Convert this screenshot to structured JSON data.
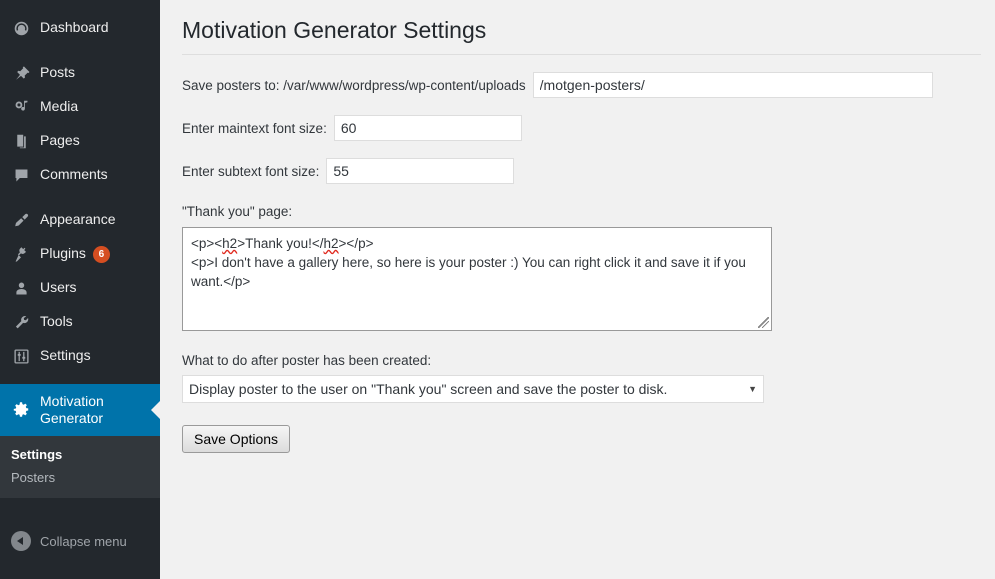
{
  "sidebar": {
    "items": [
      {
        "label": "Dashboard",
        "icon": "dashboard-icon"
      },
      {
        "label": "Posts",
        "icon": "pin-icon"
      },
      {
        "label": "Media",
        "icon": "media-icon"
      },
      {
        "label": "Pages",
        "icon": "pages-icon"
      },
      {
        "label": "Comments",
        "icon": "comment-icon"
      },
      {
        "label": "Appearance",
        "icon": "brush-icon"
      },
      {
        "label": "Plugins",
        "icon": "plug-icon",
        "badge": "6"
      },
      {
        "label": "Users",
        "icon": "user-icon"
      },
      {
        "label": "Tools",
        "icon": "wrench-icon"
      },
      {
        "label": "Settings",
        "icon": "sliders-icon"
      }
    ],
    "active_item": {
      "label": "Motivation Generator",
      "icon": "gear-icon"
    },
    "submenu": [
      {
        "label": "Settings",
        "current": true
      },
      {
        "label": "Posters",
        "current": false
      }
    ],
    "collapse_label": "Collapse menu",
    "colors": {
      "background": "#23282d",
      "submenu_background": "#32373c",
      "active": "#0073aa",
      "badge": "#d54e21"
    }
  },
  "main": {
    "page_title": "Motivation Generator Settings",
    "save_path": {
      "label": "Save posters to: /var/www/wordpress/wp-content/uploads",
      "value": "/motgen-posters/"
    },
    "maintext_font_size": {
      "label": "Enter maintext font size:",
      "value": "60"
    },
    "subtext_font_size": {
      "label": "Enter subtext font size:",
      "value": "55"
    },
    "thank_you": {
      "label": "\"Thank you\" page:",
      "line1_a": "<p><",
      "line1_spell": "h2",
      "line1_b": ">Thank you!</",
      "line1_spell2": "h2",
      "line1_c": "></p>",
      "line2": "<p>I don't have a gallery here, so here is your poster :) You can right click it and save it if you want.</p>",
      "value": "<p><h2>Thank you!</h2></p>\n<p>I don't have a gallery here, so here is your poster :) You can right click it and save it if you want.</p>"
    },
    "after_created": {
      "label": "What to do after poster has been created:",
      "selected": "Display poster to the user on \"Thank you\" screen and save the poster to disk.",
      "arrow": "▼"
    },
    "save_button": "Save Options"
  }
}
